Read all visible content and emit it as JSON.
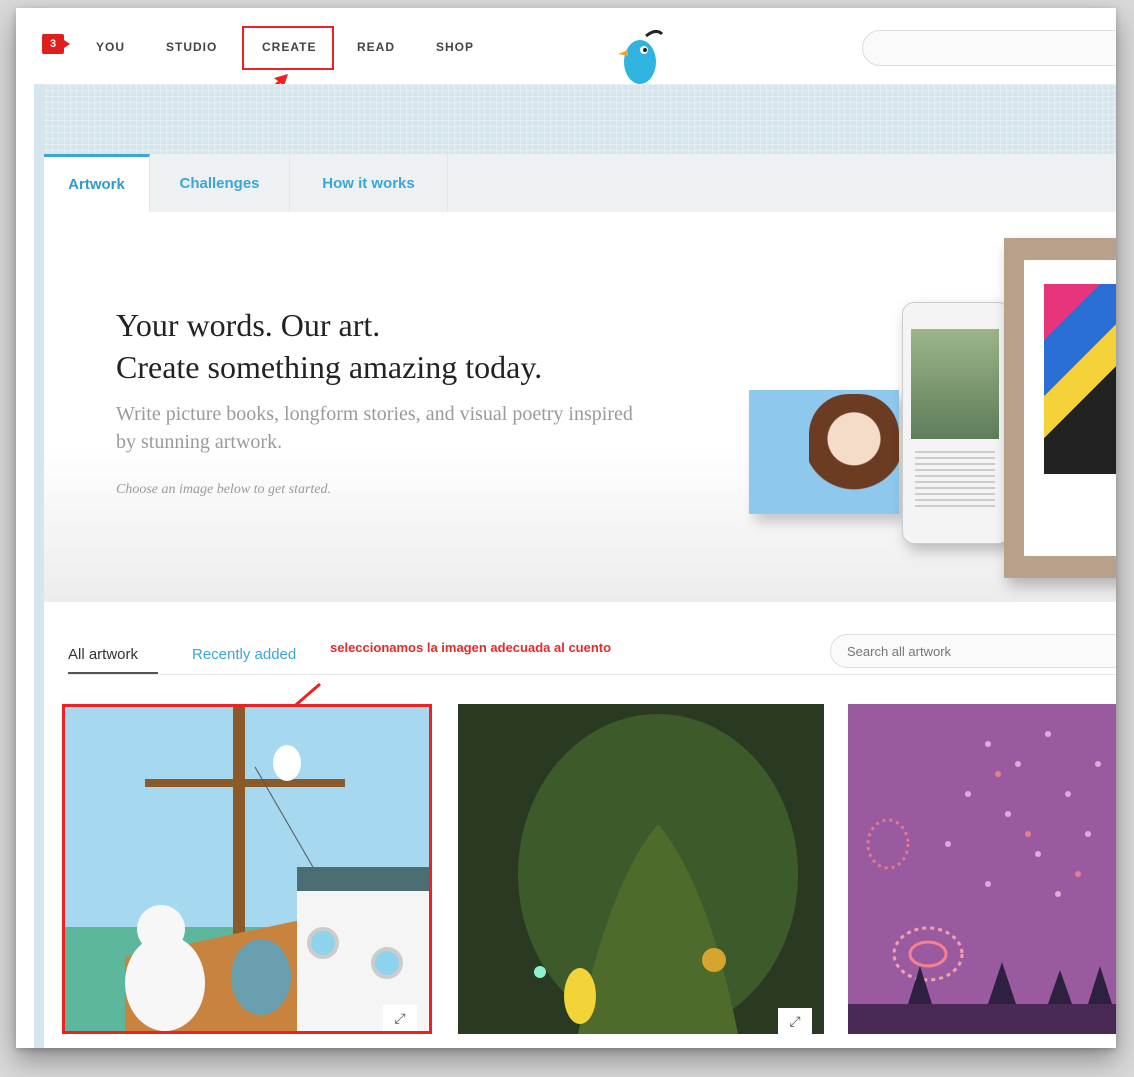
{
  "nav": {
    "badge": "3",
    "items": [
      "YOU",
      "STUDIO",
      "CREATE",
      "READ",
      "SHOP"
    ]
  },
  "tabs": [
    "Artwork",
    "Challenges",
    "How it works"
  ],
  "hero": {
    "headline_line1": "Your words. Our art.",
    "headline_line2": "Create something amazing today.",
    "subtext": "Write picture books, longform stories, and visual poetry inspired by stunning artwork.",
    "hint": "Choose an image below to get started."
  },
  "artwork_tabs": [
    "All artwork",
    "Recently added"
  ],
  "annotation": "seleccionamos la imagen adecuada al cuento",
  "search": {
    "placeholder": "Search all artwork"
  },
  "colors": {
    "accent": "#3aa7d8",
    "annotation": "#e52a2a",
    "badge": "#e01e1e"
  }
}
